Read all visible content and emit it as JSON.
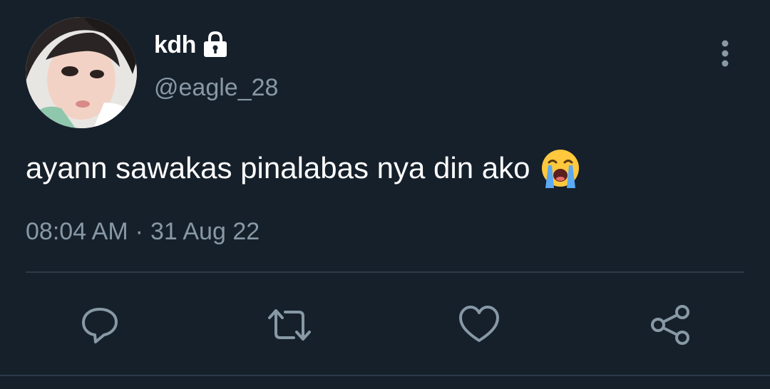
{
  "user": {
    "display_name": "kdh",
    "handle": "@eagle_28",
    "protected_icon": "lock-icon",
    "avatar": "profile-photo"
  },
  "tweet": {
    "text": "ayann sawakas pinalabas nya din ako",
    "emoji": "loudly-crying-face",
    "time": "08:04 AM",
    "separator": "·",
    "date": "31 Aug 22"
  },
  "actions": [
    {
      "icon": "reply-icon"
    },
    {
      "icon": "retweet-icon"
    },
    {
      "icon": "like-icon"
    },
    {
      "icon": "share-icon"
    }
  ],
  "menu_icon": "more-vertical-icon",
  "colors": {
    "background": "#16202b",
    "primary_text": "#ffffff",
    "secondary_text": "#8899a6",
    "divider": "#2c3a48"
  }
}
